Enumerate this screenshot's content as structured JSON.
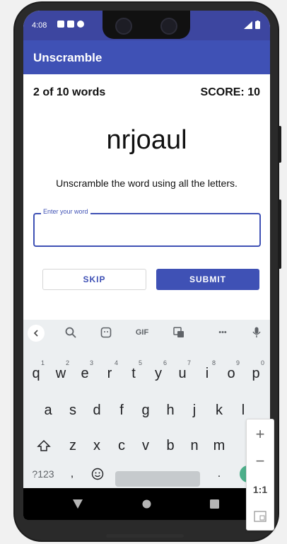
{
  "status_bar": {
    "time": "4:08"
  },
  "app_bar": {
    "title": "Unscramble"
  },
  "game": {
    "word_count": "2 of 10 words",
    "score": "SCORE: 10",
    "scrambled_word": "nrjoaul",
    "instructions": "Unscramble the word using all the letters."
  },
  "input": {
    "label": "Enter your word",
    "value": ""
  },
  "buttons": {
    "skip": "SKIP",
    "submit": "SUBMIT"
  },
  "keyboard": {
    "toolbar": {
      "gif": "GIF",
      "more": "•••"
    },
    "row1": [
      {
        "key": "q",
        "hint": "1"
      },
      {
        "key": "w",
        "hint": "2"
      },
      {
        "key": "e",
        "hint": "3"
      },
      {
        "key": "r",
        "hint": "4"
      },
      {
        "key": "t",
        "hint": "5"
      },
      {
        "key": "y",
        "hint": "6"
      },
      {
        "key": "u",
        "hint": "7"
      },
      {
        "key": "i",
        "hint": "8"
      },
      {
        "key": "o",
        "hint": "9"
      },
      {
        "key": "p",
        "hint": "0"
      }
    ],
    "row2": [
      "a",
      "s",
      "d",
      "f",
      "g",
      "h",
      "j",
      "k",
      "l"
    ],
    "row3": [
      "z",
      "x",
      "c",
      "v",
      "b",
      "n",
      "m"
    ],
    "bottom": {
      "symbols": "?123",
      "comma": ",",
      "period": "."
    }
  },
  "zoom_controls": {
    "zoom_in": "+",
    "zoom_out": "−",
    "actual_size": "1:1"
  }
}
